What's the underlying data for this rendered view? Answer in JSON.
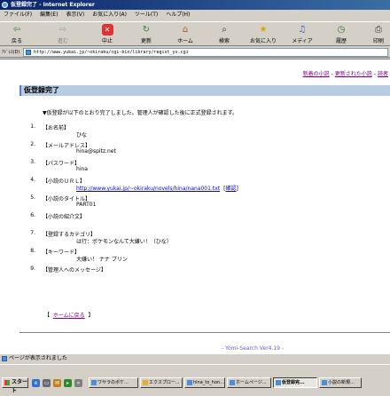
{
  "window": {
    "title": "仮登録完了 - Internet Explorer"
  },
  "menu": [
    "ファイル(F)",
    "編集(E)",
    "表示(V)",
    "お気に入り(A)",
    "ツール(T)",
    "ヘルプ(H)"
  ],
  "toolbar": {
    "back": "戻る",
    "forward": "進む",
    "stop": "中止",
    "refresh": "更新",
    "home": "ホーム",
    "search": "検索",
    "favorites": "お気に入り",
    "media": "メディア",
    "history": "履歴",
    "print": "印刷"
  },
  "address": {
    "label": "ｱﾄﾞﾚｽ(D)",
    "url": "http://www.yukai.jp/~okiraku/cgi-bin/library/regist_ys.cgi"
  },
  "toplinks": [
    "新着の小説",
    "更新された小説",
    "読者"
  ],
  "page": {
    "heading": "仮登録完了",
    "intro": "▼仮登録が以下のとおり完了しました。管理人が確認した後に正式登録されます。",
    "items": [
      {
        "num": "1.",
        "label": "【お名前】",
        "value": "ひな"
      },
      {
        "num": "2.",
        "label": "【メールアドレス】",
        "value": "hina@spitz.net"
      },
      {
        "num": "3.",
        "label": "【パスワード】",
        "value": "hina"
      },
      {
        "num": "4.",
        "label": "【小説のＵＲＬ】",
        "value": "http://www.yukai.jp/~okiraku/novels/hina/nana001.txt",
        "confirm": "確認"
      },
      {
        "num": "5.",
        "label": "【小説のタイトル】",
        "value": "PART01"
      },
      {
        "num": "6.",
        "label": "【小説の紹介文】",
        "value": ""
      },
      {
        "num": "7.",
        "label": "【登録するカテゴリ】",
        "value": "は行：ポケモンなんて大嫌い！（ひな）"
      },
      {
        "num": "8.",
        "label": "【キーワード】",
        "value": "大嫌い！ ナナ プリン"
      },
      {
        "num": "9.",
        "label": "【管理人へのメッセージ】",
        "value": ""
      }
    ],
    "back_open": "【",
    "back_link": "ホームに戻る",
    "back_close": "】",
    "footer": "- Yomi-Search Ver4.19 -"
  },
  "status": "ページが表示されました",
  "taskbar": {
    "start": "スタート",
    "tasks": [
      "ワサラのポケ...",
      "エクスプロー...",
      "hina_to_hon...",
      "ホームページ...",
      "仮登録完...",
      "小説の新規..."
    ]
  }
}
